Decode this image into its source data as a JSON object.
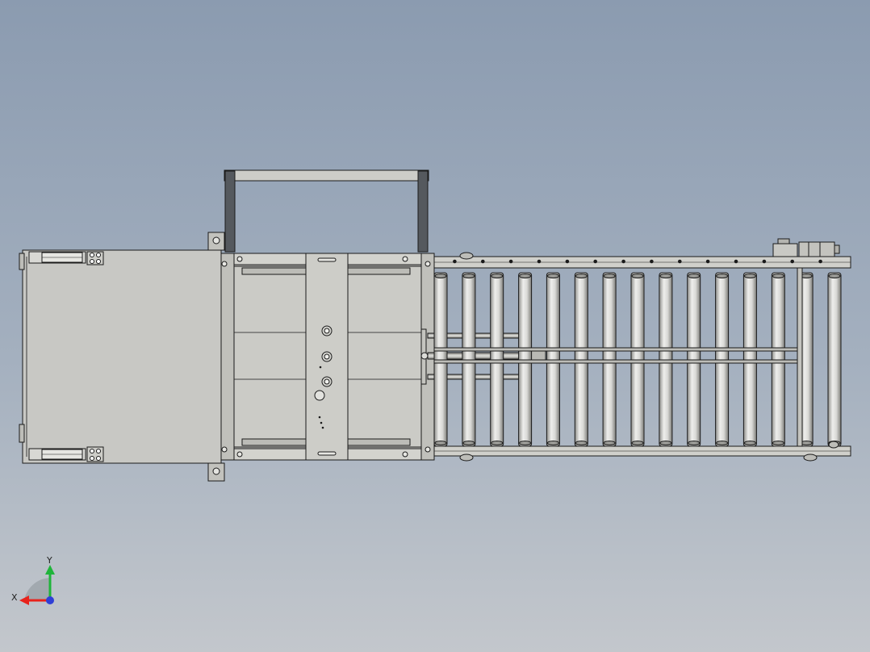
{
  "viewport": {
    "background_top": "#8b9bb0",
    "background_bottom": "#c3c7cc"
  },
  "model": {
    "colors": {
      "panel": "#c8c8c4",
      "panel_dark": "#b8b8b2",
      "frame": "#cfcfca",
      "edge": "#1a1a1a",
      "roller_light": "#eeeeec",
      "roller_dark": "#8e8e8a",
      "handle_post": "#55595e"
    },
    "roller_count": 15
  },
  "triad": {
    "x_label": "X",
    "y_label": "Y",
    "x_color": "#e8231c",
    "y_color": "#1fb43a",
    "z_color": "#2f3fd6"
  }
}
